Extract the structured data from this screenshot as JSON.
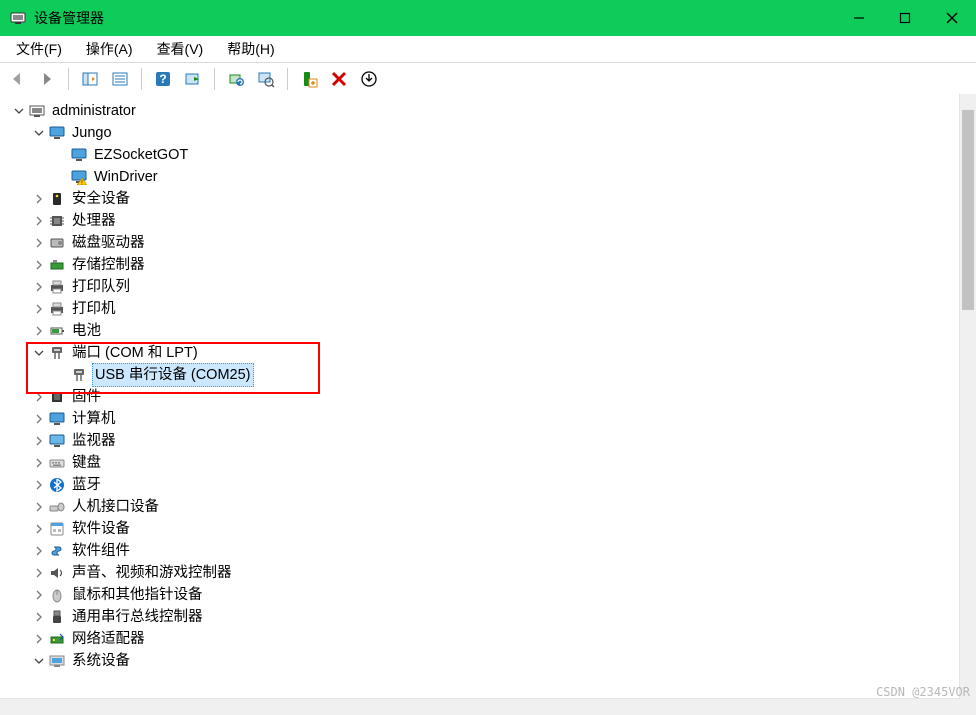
{
  "window": {
    "title": "设备管理器"
  },
  "menu": {
    "file": "文件(F)",
    "action": "操作(A)",
    "view": "查看(V)",
    "help": "帮助(H)"
  },
  "tree": {
    "root": "administrator",
    "jungo": {
      "label": "Jungo",
      "ezsocket": "EZSocketGOT",
      "windriver": "WinDriver"
    },
    "security_devices": "安全设备",
    "processors": "处理器",
    "disk_drives": "磁盘驱动器",
    "storage_controllers": "存储控制器",
    "print_queues": "打印队列",
    "printers": "打印机",
    "batteries": "电池",
    "ports": {
      "label": "端口 (COM 和 LPT)",
      "usb_serial": "USB 串行设备 (COM25)"
    },
    "firmware": "固件",
    "computer": "计算机",
    "monitors": "监视器",
    "keyboards": "键盘",
    "bluetooth": "蓝牙",
    "hid": "人机接口设备",
    "software_devices": "软件设备",
    "software_components": "软件组件",
    "sound": "声音、视频和游戏控制器",
    "mice": "鼠标和其他指针设备",
    "usb_controllers": "通用串行总线控制器",
    "network_adapters": "网络适配器",
    "system_devices": "系统设备"
  },
  "watermark": "CSDN @2345VOR"
}
